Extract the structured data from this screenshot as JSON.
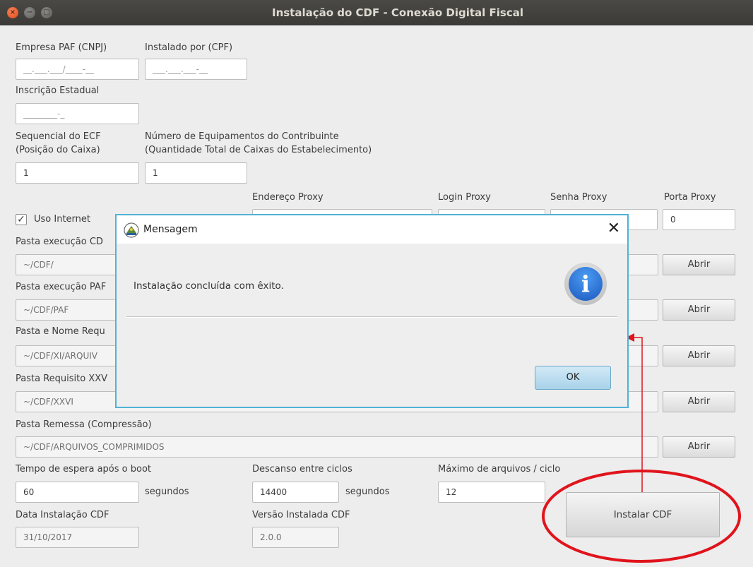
{
  "window": {
    "title": "Instalação do CDF - Conexão Digital Fiscal",
    "buttons": {
      "close": "×",
      "minimize": "−",
      "maximize": "□"
    }
  },
  "form": {
    "empresa_label": "Empresa PAF (CNPJ)",
    "empresa_value": "__.___.___/____-__",
    "instalado_label": "Instalado por (CPF)",
    "instalado_value": "___.___.___-__",
    "inscricao_label": "Inscrição Estadual",
    "inscricao_value": "________-_",
    "sequencial_label_1": "Sequencial do ECF",
    "sequencial_label_2": "(Posição do Caixa)",
    "sequencial_value": "1",
    "numero_label_1": "Número de Equipamentos do Contribuinte",
    "numero_label_2": "(Quantidade Total de Caixas do Estabelecimento)",
    "numero_value": "1",
    "endereco_proxy_label": "Endereço Proxy",
    "login_proxy_label": "Login Proxy",
    "senha_proxy_label": "Senha Proxy",
    "porta_proxy_label": "Porta Proxy",
    "porta_proxy_value": "0",
    "uso_internet_label": "Uso Internet",
    "uso_internet_checked": true,
    "pasta_exec_cdf_label": "Pasta execução CD",
    "pasta_exec_cdf_value": "~/CDF/",
    "pasta_exec_paf_label": "Pasta execução PAF",
    "pasta_exec_paf_value": "~/CDF/PAF",
    "pasta_nome_label": "Pasta e Nome Requ",
    "pasta_nome_value": "~/CDF/XI/ARQUIV",
    "pasta_req_label": "Pasta Requisito XXV",
    "pasta_req_value": "~/CDF/XXVI",
    "pasta_remessa_label": "Pasta Remessa (Compressão)",
    "pasta_remessa_value": "~/CDF/ARQUIVOS_COMPRIMIDOS",
    "abrir_label": "Abrir",
    "tempo_label": "Tempo de espera após o boot",
    "tempo_value": "60",
    "tempo_unit": "segundos",
    "descanso_label": "Descanso entre ciclos",
    "descanso_value": "14400",
    "descanso_unit": "segundos",
    "maximo_label": "Máximo de arquivos / ciclo",
    "maximo_value": "12",
    "data_label": "Data Instalação CDF",
    "data_value": "31/10/2017",
    "versao_label": "Versão Instalada CDF",
    "versao_value": "2.0.0",
    "install_button": "Instalar CDF"
  },
  "dialog": {
    "title": "Mensagem",
    "message": "Instalação concluída com êxito.",
    "ok_label": "OK",
    "close_glyph": "✕",
    "info_glyph": "i"
  },
  "annotation": {
    "color": "#e0141c"
  }
}
